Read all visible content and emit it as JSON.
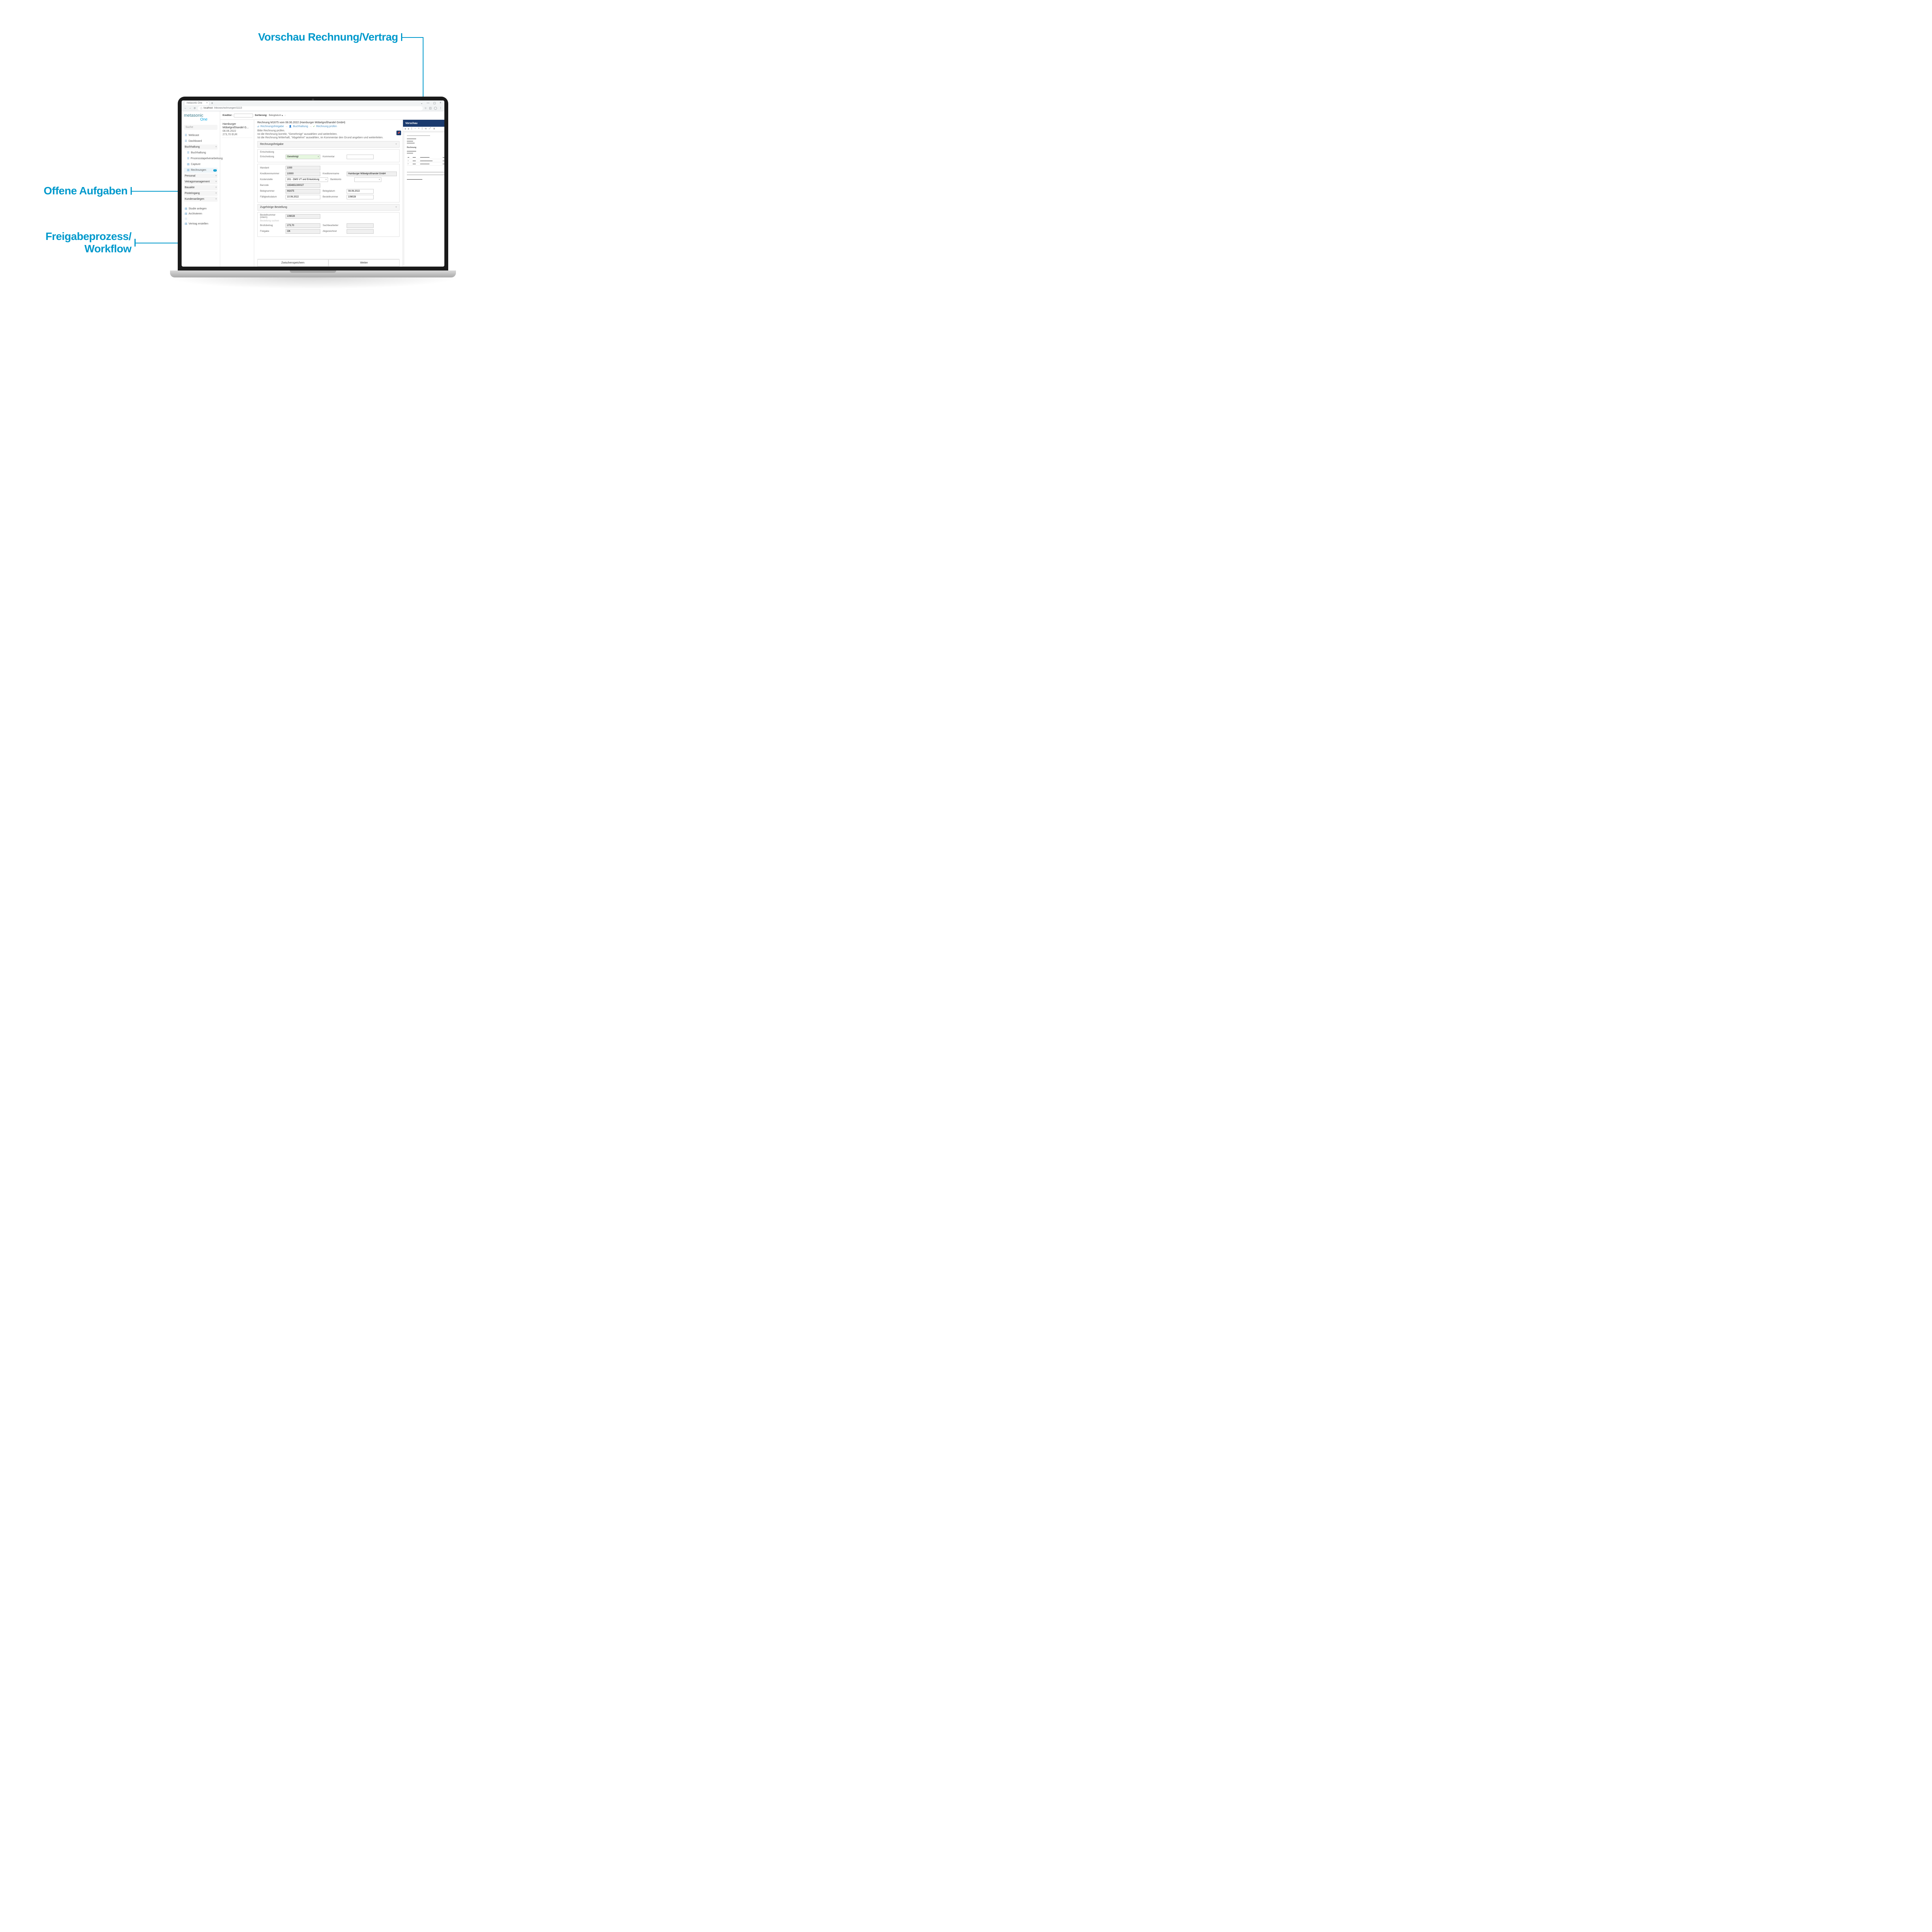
{
  "callouts": {
    "c1": "Vorschau Rechnung/Vertrag",
    "c2": "Offene Aufgaben",
    "c3_l1": "Freigabeprozess/",
    "c3_l2": "Workflow"
  },
  "browser": {
    "tab_title": "metasonic One",
    "url_host": "localhost",
    "url_path": "/inboxes/rechnungen/11113"
  },
  "brand": {
    "name": "metasonic",
    "sub": "One"
  },
  "sidebar": {
    "search": "Suche",
    "items": {
      "webcast": "Webcast",
      "dashboard": "Dashboard",
      "buchhaltung_group": "Buchhaltung",
      "buchhaltung": "Buchhaltung",
      "prozess": "Prozessstapelverarbeitung",
      "capture": "Capture",
      "rechnungen": "Rechnungen",
      "rechnungen_badge": "1",
      "personal": "Personal",
      "vertrag": "Vetragsmanagement",
      "bauakte": "Bauakte",
      "posteingang": "Posteingang",
      "kundenanliegen": "Kundenanliegen"
    },
    "actions": {
      "studie": "Studie anlegen",
      "archivieren": "Archivieren",
      "vertrag_erstellen": "Vertrag erstellen"
    }
  },
  "header": {
    "kreditor_lbl": "Kreditor:",
    "sortierung_lbl": "Sortierung:",
    "sortierung_val": "Belegdatum ▴"
  },
  "list": {
    "item1": {
      "l1": "Hamburger Möbelgroßhandel G...",
      "l2": "08.06.2022",
      "l3": "273,70 EUR"
    }
  },
  "detail": {
    "title": "Rechnung M1675 vom 08.06.2022 (Hamburger Möbelgroßhandel GmbH)",
    "bc1": "Rechnungsfreigabe",
    "bc2": "Buchhaltung",
    "bc3": "Rechnung prüfen",
    "hint1": "Bitte Rechnung prüfen.",
    "hint2": "Ist die Rechnung korrekt, \"Genehmigt\" auswählen und weiterleiten.",
    "hint3": "Ist die Rechnung fehlerhaft, \"Abgelehnt\" auswählen, im Kommentar den Grund angeben und weiterleiten.",
    "section_rechnungsfreigabe": "Rechnungsfreigabe",
    "entscheidung_head": "Entscheidung",
    "labels": {
      "entscheidung": "Entscheidung",
      "kommentar": "Kommentar",
      "mandant": "Mandant",
      "kreditornr": "Kreditorennummer",
      "kreditorname": "Kreditorenname",
      "kostenstelle": "Kostenstelle",
      "bankkonto": "Bankkonto",
      "barcode": "Barcode",
      "belegnummer": "Belegnummer",
      "belegdatum": "Belegdatum",
      "faellig": "Fälligkeitsdatum",
      "bestellnummer": "Bestellnummer",
      "zugehoerige": "Zugehörige Bestellung",
      "bestellnummer_intern": "Bestellnummer (intern)",
      "bestellung_suchen": "Bestellung suchen",
      "bruttobetrag": "Bruttobetrag",
      "sachbearbeiter": "Sachbearbeiter",
      "freigabe": "Freigabe",
      "abgezeichnet": "Abgezeichnet"
    },
    "values": {
      "entscheidung": "Genehmigt",
      "mandant": "1000",
      "kreditornr": "10000",
      "kreditorname": "Hamburger Möbelgroßhandel GmbH",
      "kostenstelle": "201 - DMS VT und Entwicklung",
      "barcode": "1654651300027",
      "belegnummer": "M1675",
      "belegdatum": "08.06.2022",
      "faellig": "10.06.2022",
      "bestellnummer": "106028",
      "bestellnummer_intern": "106028",
      "bruttobetrag": "273,70",
      "freigabe": "OK"
    },
    "footer": {
      "save": "Zwischenspeichern",
      "next": "Weiter"
    }
  },
  "preview": {
    "title": "Vorschau",
    "doc": {
      "title": "Rechnung"
    }
  }
}
